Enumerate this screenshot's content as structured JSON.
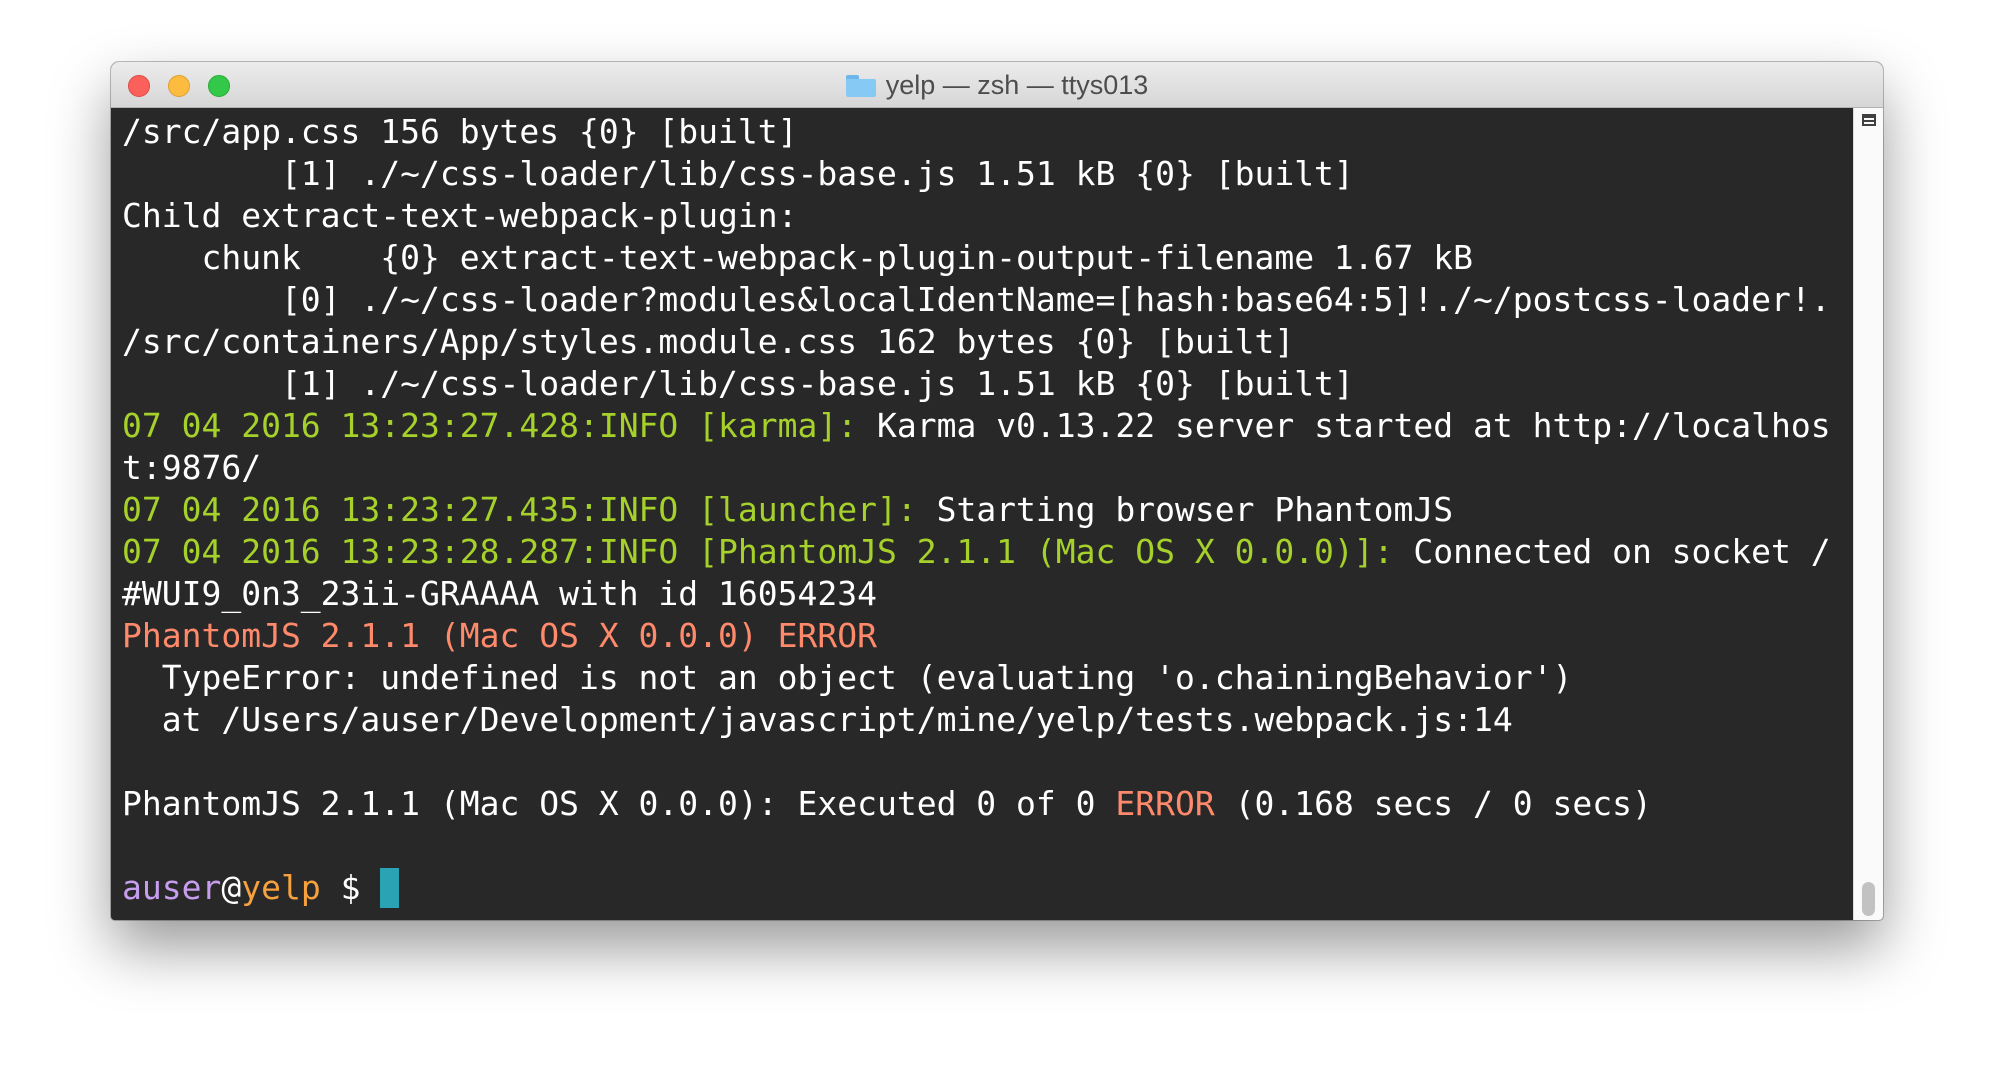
{
  "window": {
    "title": "yelp — zsh — ttys013",
    "folder_icon": "folder-icon"
  },
  "colors": {
    "background": "#282828",
    "text": "#ffffff",
    "log_info": "#a6d12b",
    "error": "#ff8a6b",
    "prompt_user": "#c79dee",
    "prompt_host": "#f5a13d",
    "cursor": "#2aa4b5"
  },
  "terminal": {
    "lines": [
      [
        {
          "t": "/src/app.css 156 bytes {0} [built]",
          "c": "white"
        }
      ],
      [
        {
          "t": "        [1] ./~/css-loader/lib/css-base.js 1.51 kB {0} [built]",
          "c": "white"
        }
      ],
      [
        {
          "t": "Child extract-text-webpack-plugin:",
          "c": "white"
        }
      ],
      [
        {
          "t": "    chunk    {0} extract-text-webpack-plugin-output-filename 1.67 kB",
          "c": "white"
        }
      ],
      [
        {
          "t": "        [0] ./~/css-loader?modules&localIdentName=[hash:base64:5]!./~/postcss-loader!.",
          "c": "white"
        }
      ],
      [
        {
          "t": "/src/containers/App/styles.module.css 162 bytes {0} [built]",
          "c": "white"
        }
      ],
      [
        {
          "t": "        [1] ./~/css-loader/lib/css-base.js 1.51 kB {0} [built]",
          "c": "white"
        }
      ],
      [
        {
          "t": "07 04 2016 13:23:27.428:INFO [karma]: ",
          "c": "green"
        },
        {
          "t": "Karma v0.13.22 server started at http://localhos",
          "c": "white"
        }
      ],
      [
        {
          "t": "t:9876/",
          "c": "white"
        }
      ],
      [
        {
          "t": "07 04 2016 13:23:27.435:INFO [launcher]: ",
          "c": "green"
        },
        {
          "t": "Starting browser PhantomJS",
          "c": "white"
        }
      ],
      [
        {
          "t": "07 04 2016 13:23:28.287:INFO [PhantomJS 2.1.1 (Mac OS X 0.0.0)]: ",
          "c": "green"
        },
        {
          "t": "Connected on socket /",
          "c": "white"
        }
      ],
      [
        {
          "t": "#WUI9_0n3_23ii-GRAAAA with id 16054234",
          "c": "white"
        }
      ],
      [
        {
          "t": "PhantomJS 2.1.1 (Mac OS X 0.0.0) ERROR",
          "c": "red"
        }
      ],
      [
        {
          "t": "  TypeError: undefined is not an object (evaluating 'o.chainingBehavior')",
          "c": "white"
        }
      ],
      [
        {
          "t": "  at /Users/auser/Development/javascript/mine/yelp/tests.webpack.js:14",
          "c": "white"
        }
      ],
      [],
      [
        {
          "t": "PhantomJS 2.1.1 (Mac OS X 0.0.0): Executed 0 of 0 ",
          "c": "white"
        },
        {
          "t": "ERROR",
          "c": "red"
        },
        {
          "t": " (0.168 secs / 0 secs)",
          "c": "white"
        }
      ],
      []
    ],
    "prompt": {
      "user": "auser",
      "at": "@",
      "host": "yelp",
      "symbol": " $ "
    }
  }
}
